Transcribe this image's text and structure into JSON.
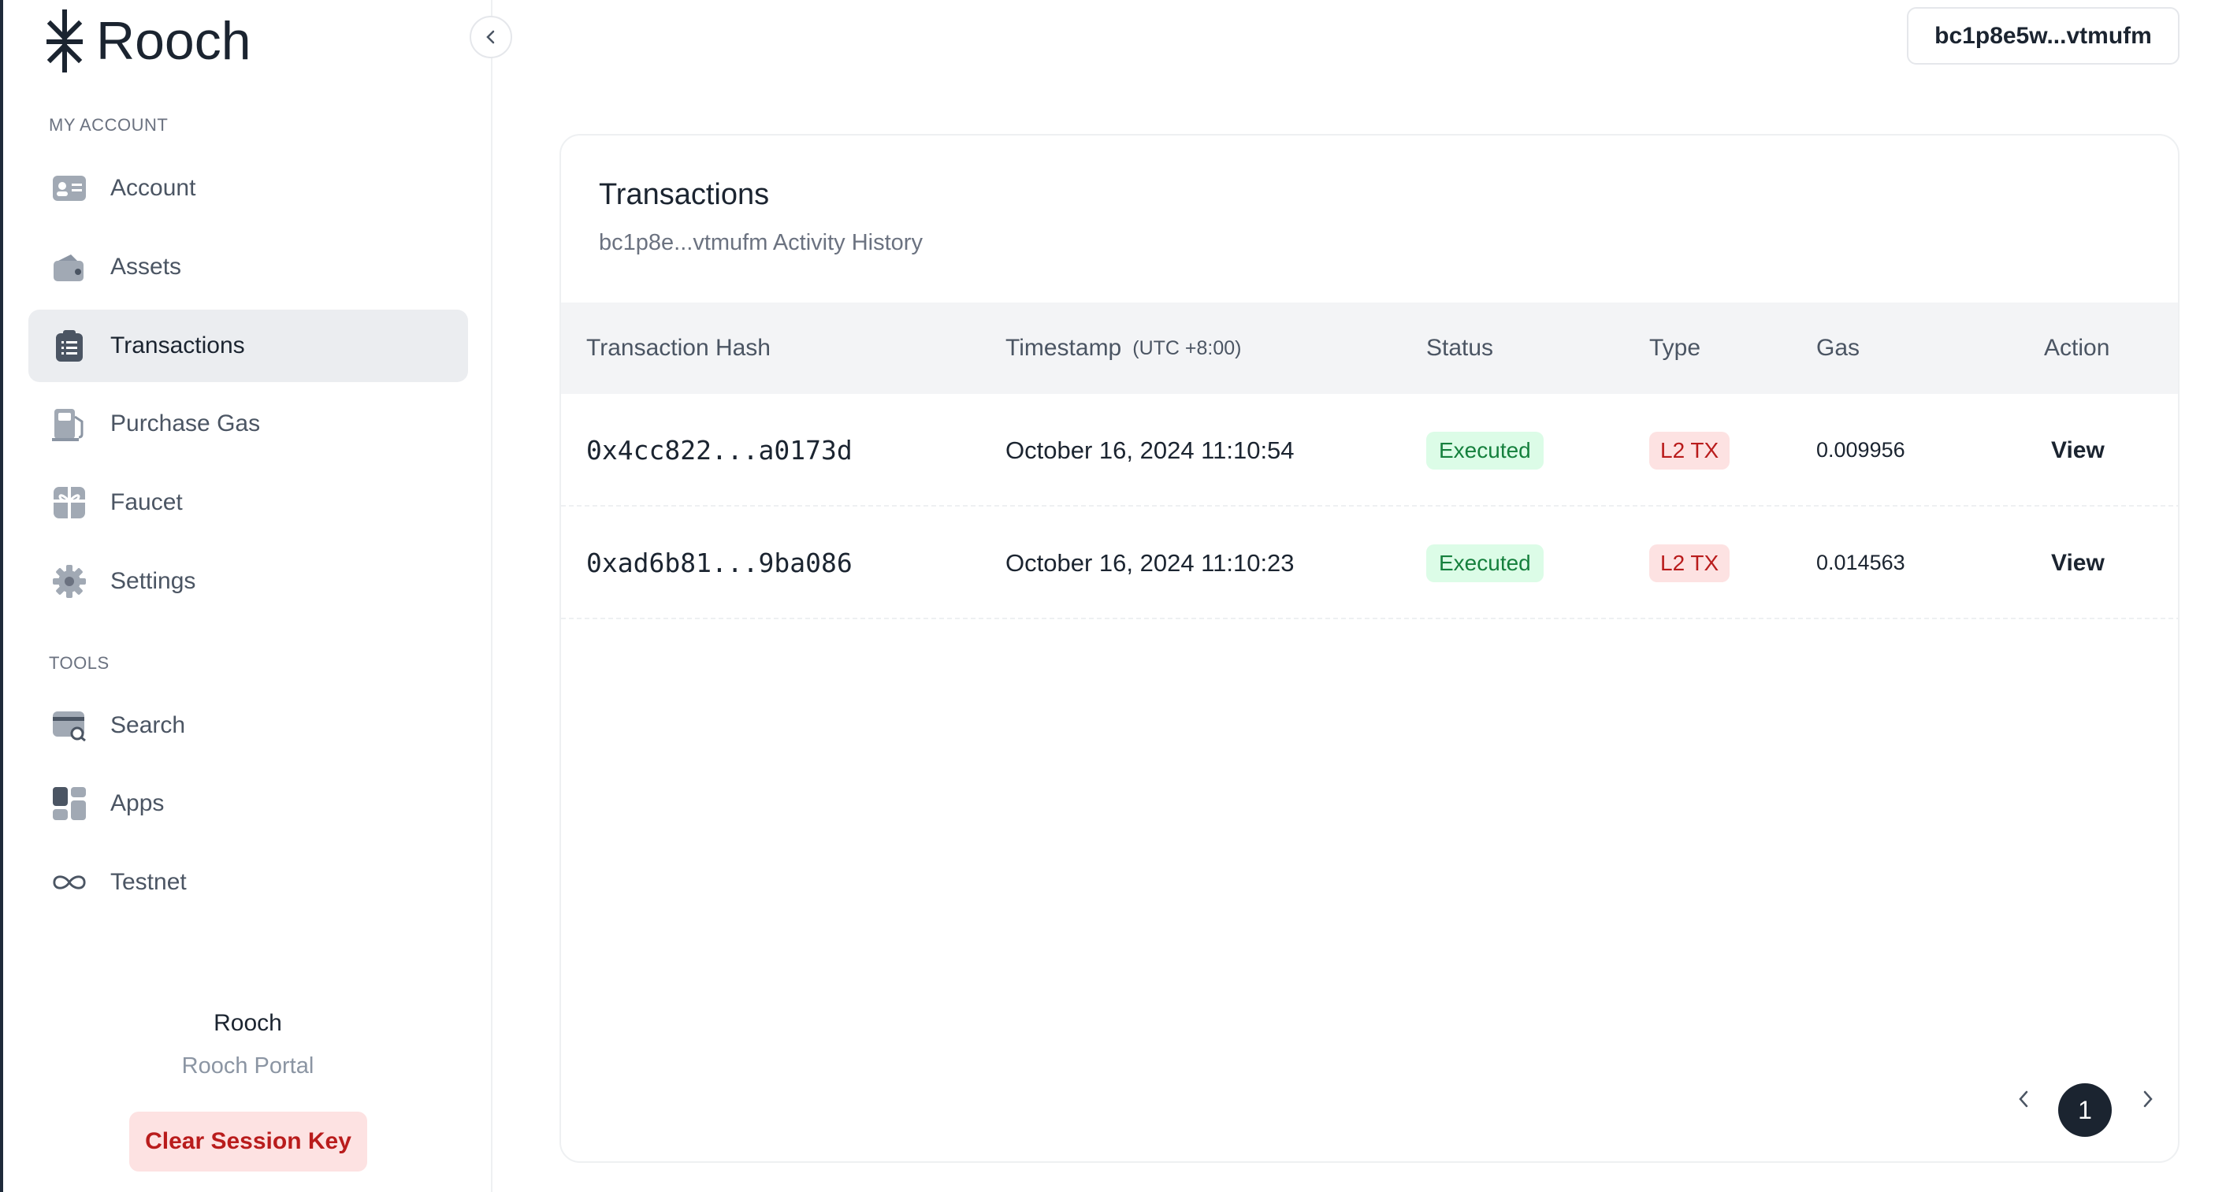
{
  "brand": {
    "name": "Rooch"
  },
  "sidebar": {
    "sections": [
      {
        "label": "MY ACCOUNT"
      },
      {
        "label": "TOOLS"
      }
    ],
    "items": [
      {
        "label": "Account",
        "icon": "id-card-icon"
      },
      {
        "label": "Assets",
        "icon": "wallet-icon"
      },
      {
        "label": "Transactions",
        "icon": "clipboard-list-icon",
        "active": true
      },
      {
        "label": "Purchase Gas",
        "icon": "gas-pump-icon"
      },
      {
        "label": "Faucet",
        "icon": "gift-icon"
      },
      {
        "label": "Settings",
        "icon": "gear-icon"
      },
      {
        "label": "Search",
        "icon": "search-card-icon"
      },
      {
        "label": "Apps",
        "icon": "apps-grid-icon"
      },
      {
        "label": "Testnet",
        "icon": "infinity-icon"
      }
    ],
    "footer": {
      "title": "Rooch",
      "subtitle": "Rooch Portal",
      "clear_button": "Clear Session Key"
    }
  },
  "header": {
    "wallet_address": "bc1p8e5w...vtmufm"
  },
  "main": {
    "title": "Transactions",
    "subtitle": "bc1p8e...vtmufm Activity History",
    "table": {
      "columns": {
        "hash": "Transaction Hash",
        "timestamp": "Timestamp",
        "timezone": "(UTC +8:00)",
        "status": "Status",
        "type": "Type",
        "gas": "Gas",
        "action": "Action"
      },
      "rows": [
        {
          "hash": "0x4cc822...a0173d",
          "timestamp": "October 16, 2024 11:10:54",
          "status": "Executed",
          "type": "L2 TX",
          "gas": "0.009956",
          "action": "View"
        },
        {
          "hash": "0xad6b81...9ba086",
          "timestamp": "October 16, 2024 11:10:23",
          "status": "Executed",
          "type": "L2 TX",
          "gas": "0.014563",
          "action": "View"
        }
      ]
    },
    "pagination": {
      "current_page": "1"
    }
  },
  "colors": {
    "accent_dark": "#1b2430",
    "active_bg": "#ebedf0",
    "status_green": "#15803d",
    "type_red": "#b91c1c"
  }
}
